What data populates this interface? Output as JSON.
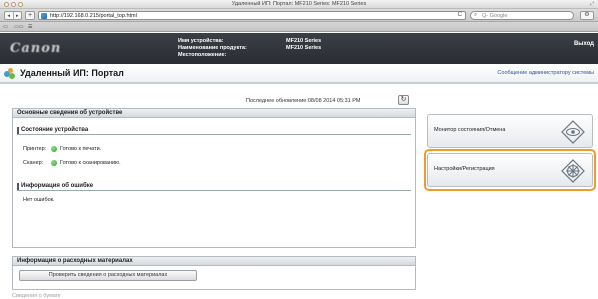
{
  "window": {
    "title": "Удаленный ИП: Портал: MF210 Series: MF210 Series",
    "url": "http://192.168.0.215/portal_top.html",
    "reload_glyph": "C",
    "search_placeholder": "Q- Google",
    "nav_back": "◂",
    "nav_forward": "▸",
    "plus": "+",
    "bookmark_items": [
      "▭",
      "▭▭",
      "☰"
    ]
  },
  "header": {
    "logo_text": "Canon",
    "rows": [
      {
        "label": "Имя устройства:",
        "value": "MF210 Series"
      },
      {
        "label": "Наименование продукта:",
        "value": "MF210 Series"
      },
      {
        "label": "Местоположение:",
        "value": ""
      }
    ],
    "logout_label": "Выход"
  },
  "portal": {
    "title": "Удаленный ИП: Портал",
    "admin_message_link": "Сообщение администратору системы",
    "last_updated": "Последнее обновление:08/08 2014 05:31 PM"
  },
  "basic_info": {
    "section_title": "Основные сведения об устройстве",
    "device_status_title": "Состояние устройства",
    "status_rows": [
      {
        "label": "Принтер:",
        "status": "Готово к печати."
      },
      {
        "label": "Сканер:",
        "status": "Готово к сканированию."
      }
    ],
    "error_info_title": "Информация об ошибке",
    "error_info_text": "Нет ошибок."
  },
  "consumables": {
    "section_title": "Информация о расходных материалах",
    "check_button_label": "Проверить сведения о расходных материалах",
    "next_section_partial": "Сведения о бумаге"
  },
  "menu": {
    "items": [
      {
        "label": "Монитор состояния/Отмена",
        "icon": "monitor-eye-icon"
      },
      {
        "label": "Настройки/Регистрация",
        "icon": "settings-wheel-icon"
      }
    ],
    "highlight_color": "#f39a2c"
  },
  "colors": {
    "header_bg": "#2f3238",
    "status_ok": "#2c9a2c",
    "link": "#2b55a0"
  }
}
